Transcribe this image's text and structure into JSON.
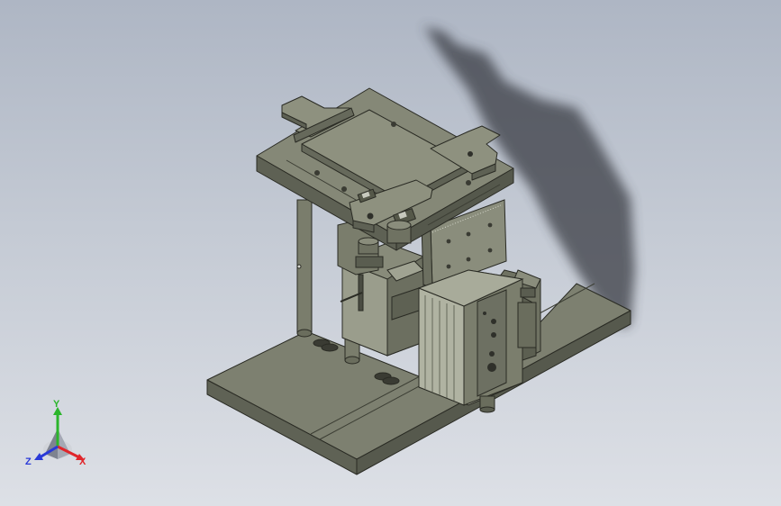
{
  "viewport": {
    "background_top": "#aeb6c4",
    "background_bottom": "#dde0e6"
  },
  "model": {
    "part_color": "#7a7d6c",
    "edge_color": "#2a2b24",
    "shadow_color": "#3a3d44"
  },
  "triad": {
    "x_label": "X",
    "y_label": "Y",
    "z_label": "Z",
    "x_color": "#e0262b",
    "y_color": "#2bb52b",
    "z_color": "#2a3ad8"
  }
}
